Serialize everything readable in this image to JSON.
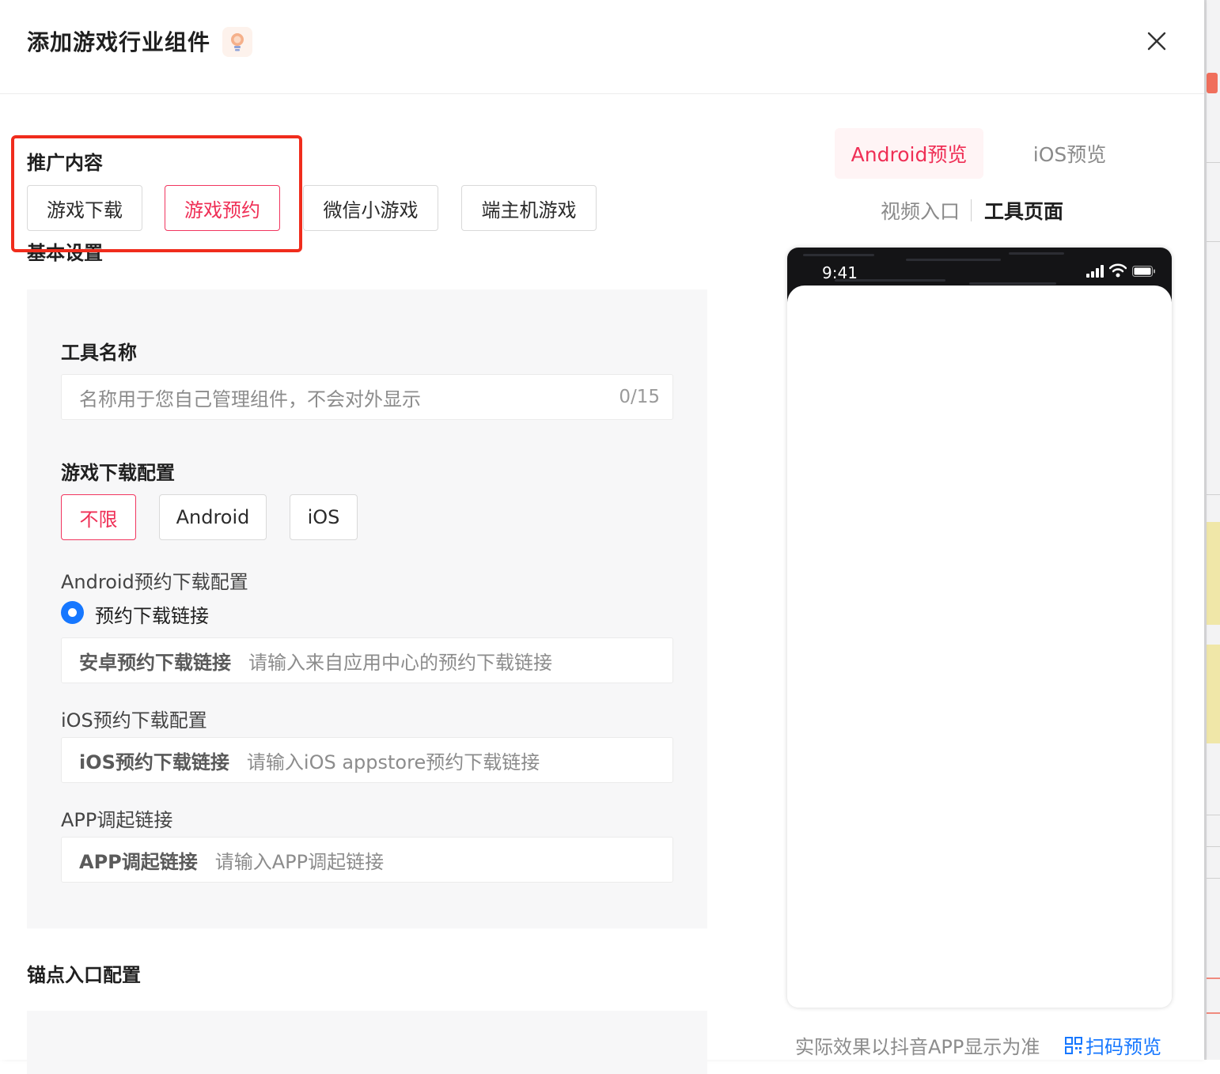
{
  "modal": {
    "title": "添加游戏行业组件"
  },
  "promotion": {
    "title": "推广内容",
    "options": [
      {
        "label": "游戏下载",
        "active": false
      },
      {
        "label": "游戏预约",
        "active": true
      },
      {
        "label": "微信小游戏",
        "active": false
      },
      {
        "label": "端主机游戏",
        "active": false
      }
    ]
  },
  "basic_settings": {
    "title": "基本设置",
    "tool_name": {
      "label": "工具名称",
      "placeholder": "名称用于您自己管理组件，不会对外显示",
      "counter": "0/15"
    },
    "download_config": {
      "label": "游戏下载配置",
      "platforms": [
        {
          "label": "不限",
          "active": true
        },
        {
          "label": "Android",
          "active": false
        },
        {
          "label": "iOS",
          "active": false
        }
      ]
    },
    "android_config": {
      "label": "Android预约下载配置",
      "radio_label": "预约下载链接",
      "input_label": "安卓预约下载链接",
      "input_placeholder": "请输入来自应用中心的预约下载链接"
    },
    "ios_config": {
      "label": "iOS预约下载配置",
      "input_label": "iOS预约下载链接",
      "input_placeholder": "请输入iOS appstore预约下载链接"
    },
    "app_link": {
      "label": "APP调起链接",
      "input_label": "APP调起链接",
      "input_placeholder": "请输入APP调起链接"
    }
  },
  "anchor": {
    "title": "锚点入口配置"
  },
  "preview": {
    "platform_tabs": [
      "Android预览",
      "iOS预览"
    ],
    "active_platform": "Android预览",
    "sub_tabs": [
      "视频入口",
      "工具页面"
    ],
    "active_sub_tab": "工具页面",
    "phone_time": "9:41",
    "footer_note": "实际效果以抖音APP显示为准",
    "scan_label": "扫码预览"
  },
  "colors": {
    "accent_red": "#ef2f56",
    "link_blue": "#1677ff",
    "highlight_box": "#f02c1c"
  }
}
